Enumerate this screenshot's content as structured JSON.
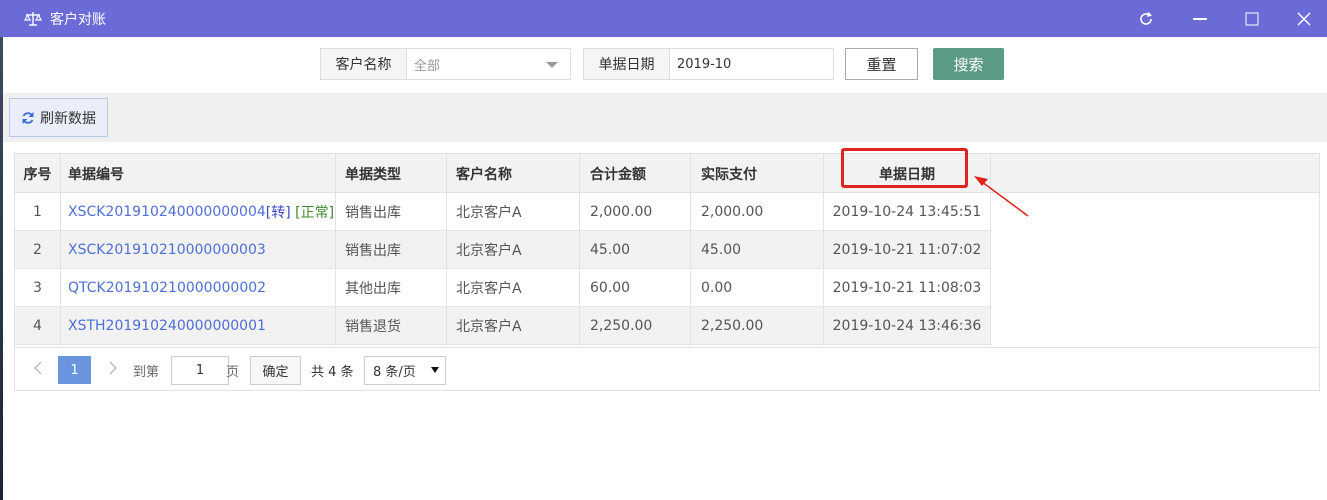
{
  "window": {
    "title": "客户对账",
    "app_icon": "scale-icon",
    "controls": [
      "refresh-icon",
      "minimize-icon",
      "maximize-icon",
      "close-icon"
    ],
    "accent_color": "#6a6bd6"
  },
  "search": {
    "customer_label": "客户名称",
    "customer_value": "全部",
    "date_label": "单据日期",
    "date_value": "2019-10",
    "reset_label": "重置",
    "search_label": "搜索",
    "search_color": "#5b9a83"
  },
  "toolbar": {
    "refresh_label": "刷新数据"
  },
  "table": {
    "columns": [
      "序号",
      "单据编号",
      "单据类型",
      "客户名称",
      "合计金额",
      "实际支付",
      "单据日期"
    ],
    "rows": [
      {
        "index": "1",
        "doc_no": "XSCK201910240000000004",
        "tag1": "[转]",
        "tag2": "[正常]",
        "type": "销售出库",
        "customer": "北京客户A",
        "total": "2,000.00",
        "paid": "2,000.00",
        "date": "2019-10-24 13:45:51"
      },
      {
        "index": "2",
        "doc_no": "XSCK201910210000000003",
        "type": "销售出库",
        "customer": "北京客户A",
        "total": "45.00",
        "paid": "45.00",
        "date": "2019-10-21 11:07:02"
      },
      {
        "index": "3",
        "doc_no": "QTCK201910210000000002",
        "type": "其他出库",
        "customer": "北京客户A",
        "total": "60.00",
        "paid": "0.00",
        "date": "2019-10-21 11:08:03"
      },
      {
        "index": "4",
        "doc_no": "XSTH201910240000000001",
        "type": "销售退货",
        "customer": "北京客户A",
        "total": "2,250.00",
        "paid": "2,250.00",
        "date": "2019-10-24 13:46:36"
      }
    ]
  },
  "pagination": {
    "current_page": "1",
    "goto_label": "到第",
    "goto_value": "1",
    "page_label": "页",
    "confirm_label": "确定",
    "total_label": "共 4 条",
    "page_size": "8 条/页"
  },
  "annotation": {
    "color": "#e0231c"
  }
}
